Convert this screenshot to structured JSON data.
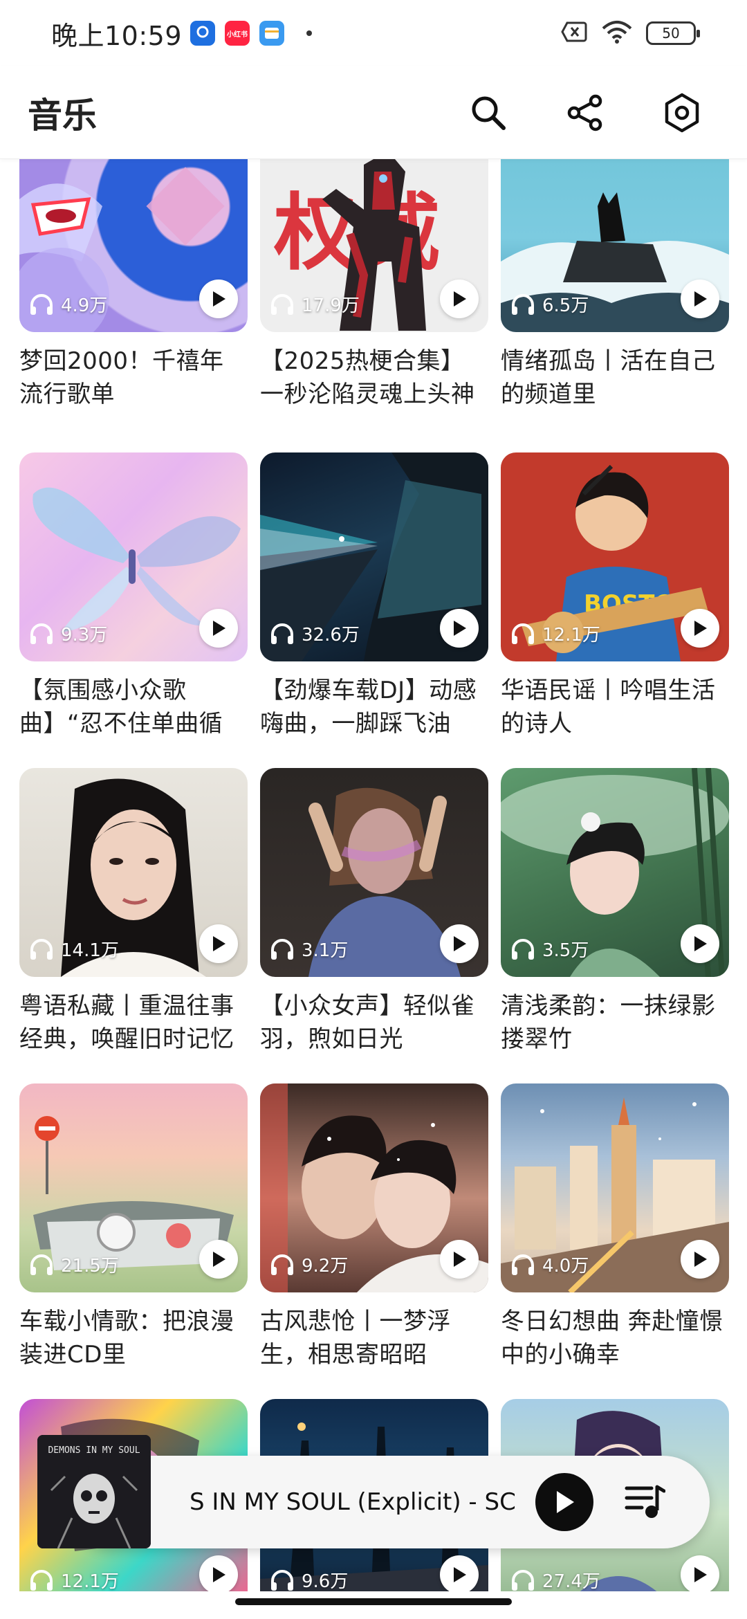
{
  "status_bar": {
    "time": "晚上10:59",
    "battery": "50",
    "apps": [
      {
        "label": "",
        "color": "#1e6fe0"
      },
      {
        "label": "小红书",
        "color": "#ff2442"
      },
      {
        "label": "",
        "color": "#3a9af0"
      }
    ]
  },
  "header": {
    "title": "音乐",
    "icons": [
      "search-icon",
      "share-icon",
      "settings-icon"
    ]
  },
  "grid": {
    "cards": [
      {
        "title": "梦回2000！千禧年流行歌单",
        "plays": "4.9万"
      },
      {
        "title": "【2025热梗合集】一秒沦陷灵魂上头神",
        "plays": "17.9万"
      },
      {
        "title": "情绪孤岛丨活在自己的频道里",
        "plays": "6.5万"
      },
      {
        "title": "【氛围感小众歌曲】“忍不住单曲循环！”",
        "plays": "9.3万"
      },
      {
        "title": "【劲爆车载DJ】动感嗨曲，一脚踩飞油",
        "plays": "32.6万"
      },
      {
        "title": "华语民谣丨吟唱生活的诗人",
        "plays": "12.1万"
      },
      {
        "title": "粤语私藏丨重温往事经典，唤醒旧时记忆",
        "plays": "14.1万"
      },
      {
        "title": "【小众女声】轻似雀羽，煦如日光",
        "plays": "3.1万"
      },
      {
        "title": "清浅柔韵：一抹绿影搂翠竹",
        "plays": "3.5万"
      },
      {
        "title": "车载小情歌：把浪漫装进CD里",
        "plays": "21.5万"
      },
      {
        "title": "古风悲怆丨一梦浮生，相思寄昭昭",
        "plays": "9.2万"
      },
      {
        "title": "冬日幻想曲 奔赴憧憬中的小确幸",
        "plays": "4.0万"
      },
      {
        "title": "",
        "plays": "12.1万"
      },
      {
        "title": "",
        "plays": "9.6万"
      },
      {
        "title": "",
        "plays": "27.4万"
      }
    ]
  },
  "cover_art": {
    "card1_text": "权威"
  },
  "mini_player": {
    "track": "S IN MY SOUL (Explicit) - SC",
    "album_art_text": "DEMONS IN MY SOUL"
  }
}
